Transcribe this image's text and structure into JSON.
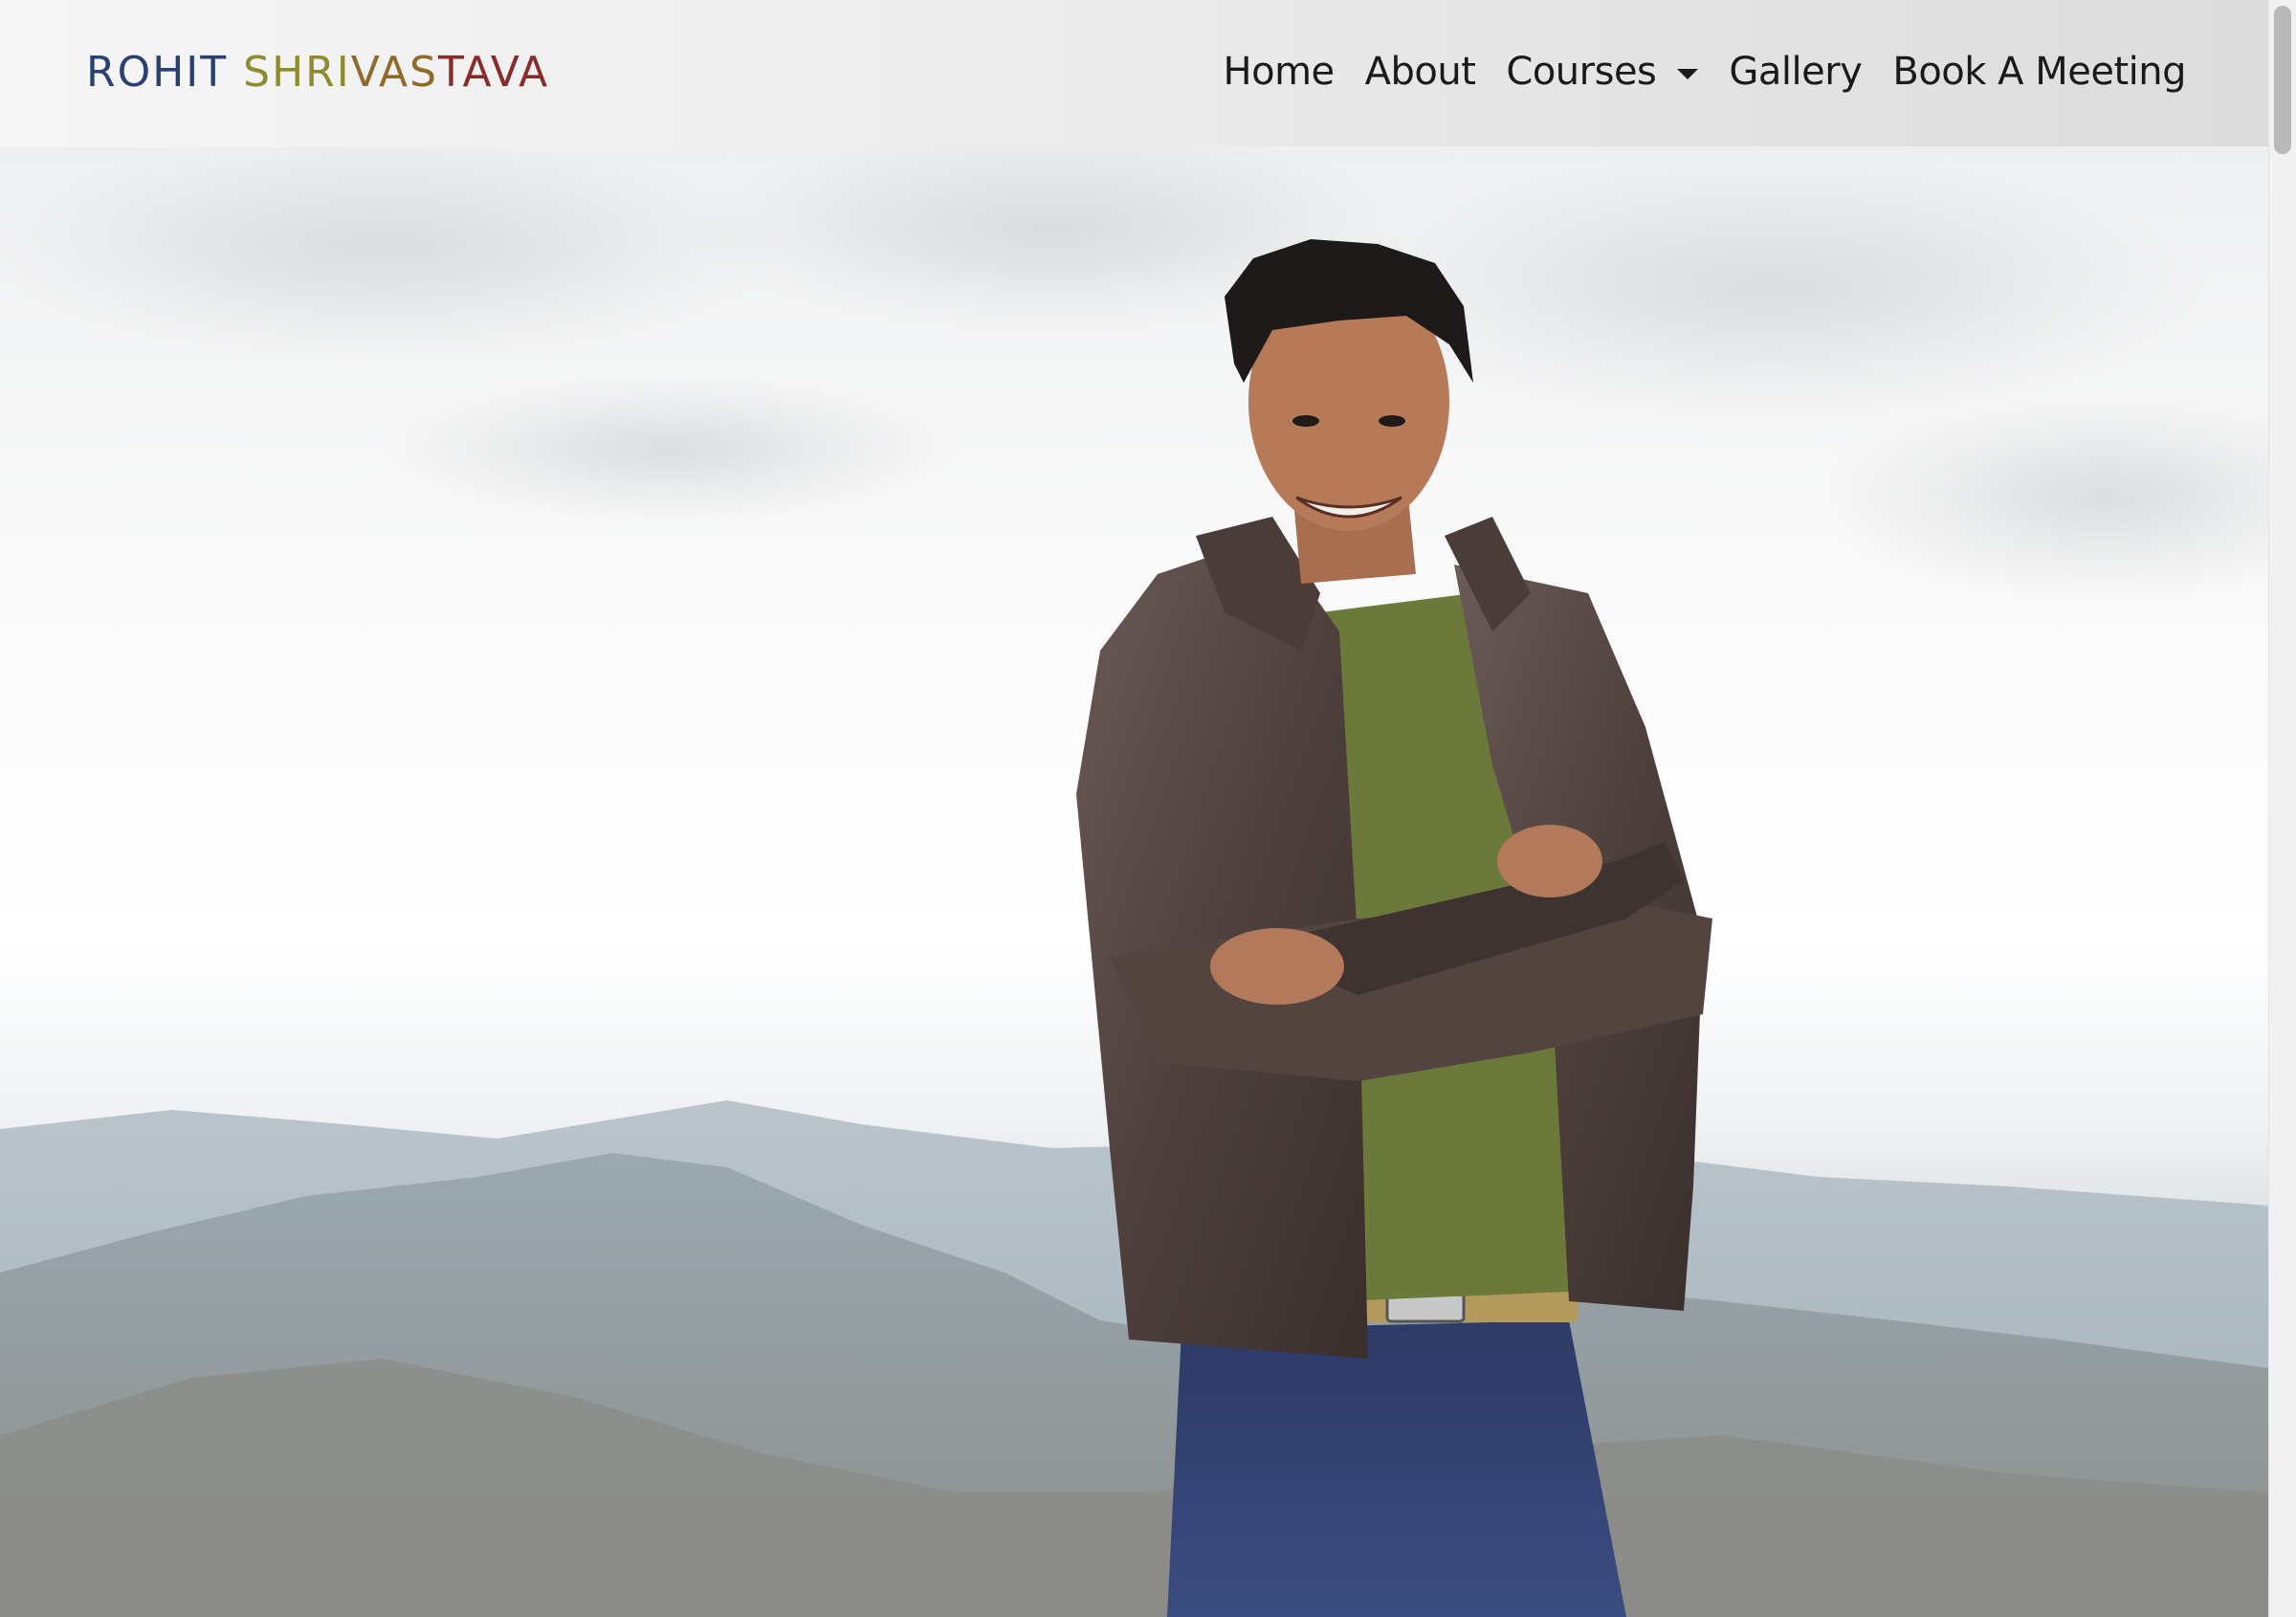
{
  "brand": {
    "part1": "ROHIT",
    "part2": " SHRI",
    "part3": "VAS",
    "part4": "TAVA"
  },
  "nav": {
    "items": [
      {
        "label": "Home"
      },
      {
        "label": "About"
      },
      {
        "label": "Courses",
        "has_dropdown": true
      },
      {
        "label": "Gallery"
      },
      {
        "label": "Book A Meeting"
      }
    ]
  },
  "hero": {
    "image": "portrait-photo"
  },
  "colors": {
    "brand_blue": "#2b3f73",
    "brand_olive": "#8d8b2e",
    "brand_brown": "#8f6a2a",
    "brand_red": "#8a2b2b",
    "nav_text": "#1a1a1a"
  }
}
